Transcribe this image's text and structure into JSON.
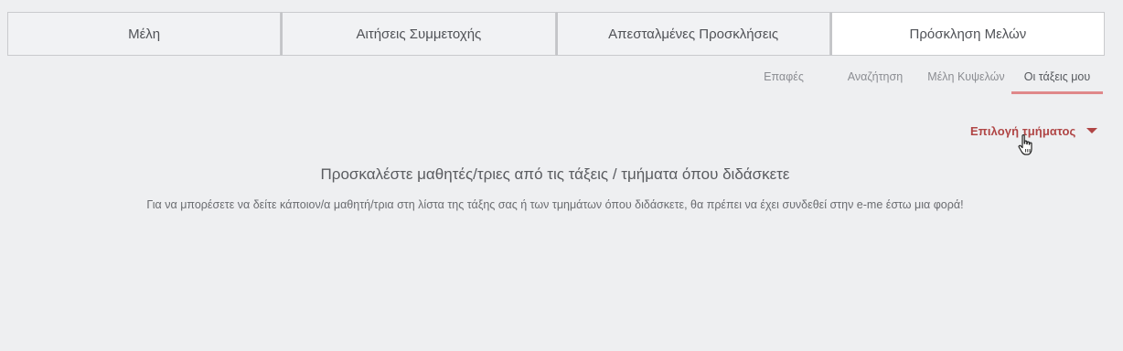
{
  "main_tabs": [
    {
      "label": "Μέλη",
      "active": false
    },
    {
      "label": "Αιτήσεις Συμμετοχής",
      "active": false
    },
    {
      "label": "Απεσταλμένες Προσκλήσεις",
      "active": false
    },
    {
      "label": "Πρόσκληση Μελών",
      "active": true
    }
  ],
  "sub_tabs": [
    {
      "label": "Επαφές",
      "active": false
    },
    {
      "label": "Αναζήτηση",
      "active": false
    },
    {
      "label": "Μέλη Κυψελών",
      "active": false
    },
    {
      "label": "Οι τάξεις μου",
      "active": true
    }
  ],
  "department_select": {
    "label": "Επιλογή τμήματος",
    "icon": "chevron-down-icon"
  },
  "content": {
    "heading": "Προσκαλέστε μαθητές/τριες από τις τάξεις / τμήματα όπου διδάσκετε",
    "description": "Για να μπορέσετε να δείτε κάποιον/α μαθητή/τρια στη λίστα της τάξης σας ή των τμημάτων όπου διδάσκετε, θα πρέπει να έχει συνδεθεί στην e-me έστω μια φορά!"
  },
  "colors": {
    "accent": "#b04545",
    "active_underline": "#e0888a",
    "background": "#eeeff1"
  }
}
